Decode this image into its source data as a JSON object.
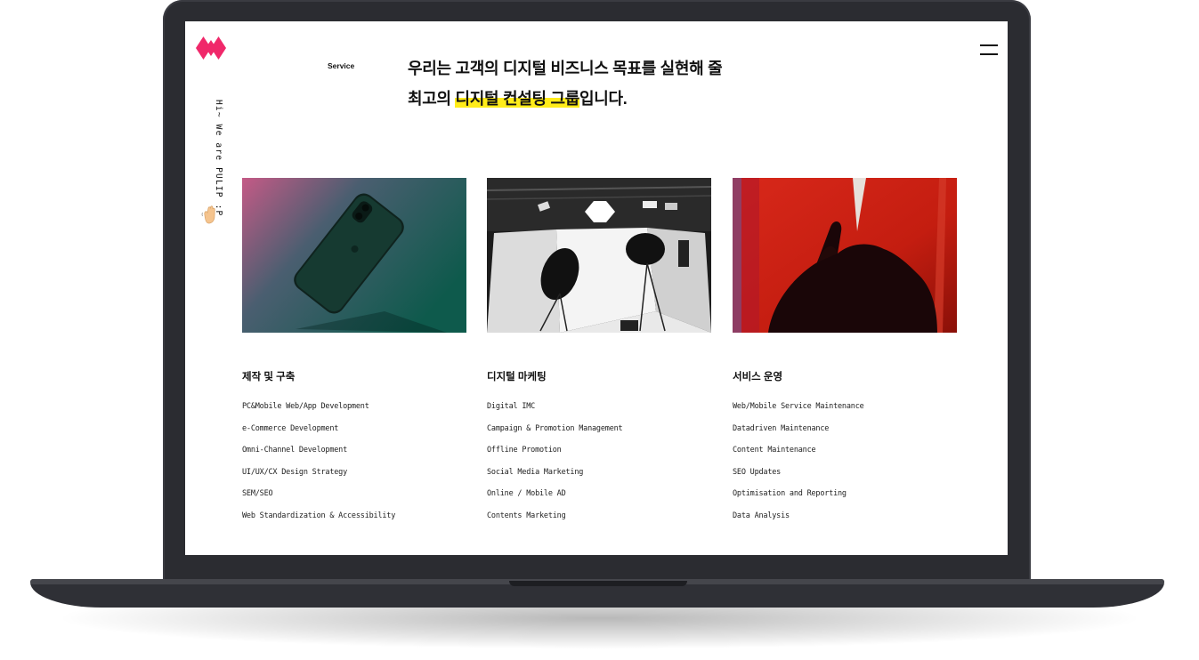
{
  "header": {
    "section_label": "Service",
    "headline_line1": "우리는 고객의 디지털 비즈니스 목표를 실현해 줄",
    "headline_line2_prefix": "최고의 ",
    "headline_line2_highlight": "디지털 컨설팅 그룹",
    "headline_line2_suffix": "입니다."
  },
  "sidebar": {
    "greeting": "Hi~ We are PULIP :P"
  },
  "colors": {
    "brand": "#f0286a",
    "highlight": "#ffec1a",
    "laptop_frame": "#2b2c31"
  },
  "services": [
    {
      "title": "제작 및 구축",
      "image": "phone-on-gradient-photo",
      "items": [
        "PC&Mobile Web/App Development",
        "e-Commerce Development",
        "Omni-Channel Development",
        "UI/UX/CX Design Strategy",
        "SEM/SEO",
        "Web Standardization & Accessibility"
      ]
    },
    {
      "title": "디지털 마케팅",
      "image": "photo-studio-photo",
      "items": [
        "Digital IMC",
        "Campaign & Promotion Management",
        "Offline Promotion",
        "Social Media Marketing",
        "Online / Mobile AD",
        "Contents Marketing"
      ]
    },
    {
      "title": "서비스 운영",
      "image": "hand-on-red-photo",
      "items": [
        "Web/Mobile Service Maintenance",
        "Datadriven Maintenance",
        "Content Maintenance",
        "SEO Updates",
        "Optimisation and Reporting",
        "Data Analysis"
      ]
    }
  ]
}
